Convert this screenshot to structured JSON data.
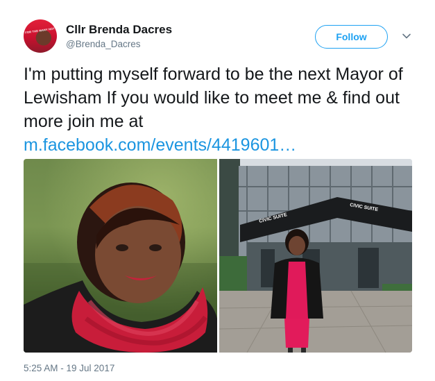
{
  "author": {
    "display_name": "Cllr Brenda Dacres",
    "handle": "@Brenda_Dacres",
    "avatar_text": "FOR THE MANY NOT THE FEW"
  },
  "actions": {
    "follow_label": "Follow"
  },
  "tweet": {
    "text": "I'm putting myself forward to be the next Mayor of Lewisham If you would like to meet me &  find out more join me at ",
    "link_text": "m.facebook.com/events/4419601…"
  },
  "media": {
    "right_photo_sign_left": "CIVIC SUITE",
    "right_photo_sign_right": "CIVIC SUITE"
  },
  "meta": {
    "timestamp": "5:25 AM - 19 Jul 2017"
  },
  "colors": {
    "accent": "#1da1f2",
    "link": "#1b95e0",
    "muted": "#657786"
  }
}
